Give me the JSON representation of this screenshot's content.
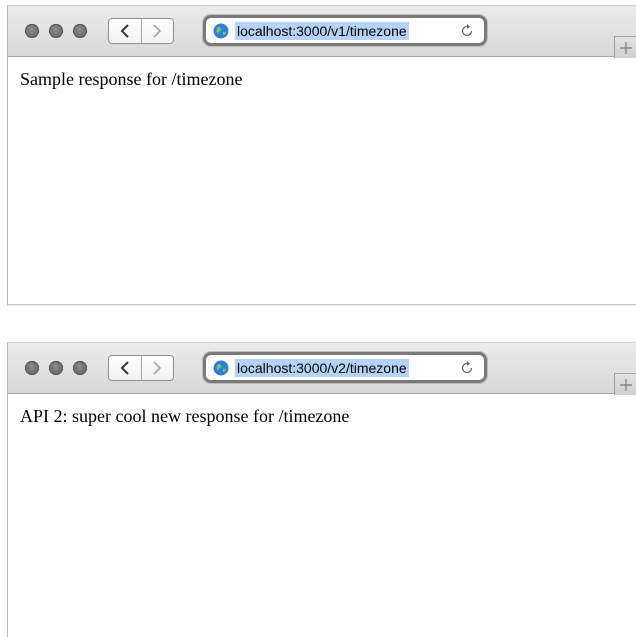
{
  "windows": [
    {
      "address_bar": {
        "url": "localhost:3000/v1/timezone"
      },
      "content": {
        "text": "Sample response for /timezone"
      }
    },
    {
      "address_bar": {
        "url": "localhost:3000/v2/timezone"
      },
      "content": {
        "text": "API 2: super cool new response for /timezone"
      }
    }
  ],
  "icons": {
    "back": "chevron-left-icon",
    "forward": "chevron-right-icon",
    "site": "globe-icon",
    "reload": "reload-icon",
    "new_tab": "plus-icon"
  },
  "colors": {
    "url_selection": "#b5d3fa",
    "traffic_light": "#6b6b6b"
  }
}
